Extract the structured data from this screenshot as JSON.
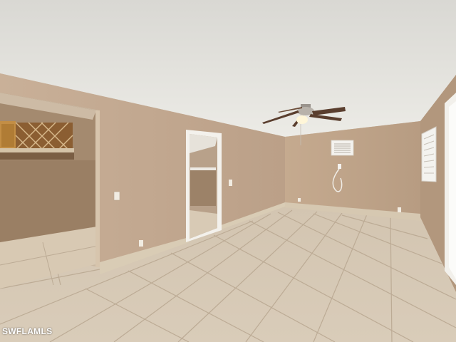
{
  "photo": {
    "subject": "empty-room-interior",
    "elements": [
      "ceiling",
      "ceiling-fan",
      "doorway",
      "closet-opening",
      "window",
      "wall-vent",
      "tile-floor"
    ],
    "colors": {
      "ceiling": "#e4e3de",
      "wall": "#c2a78c",
      "wall_shadow": "#a88d72",
      "floor": "#d9ccb8",
      "floor_grout": "#bfae98",
      "baseboard": "#d8cbb4",
      "trim": "#f2f0ea",
      "fan_blade": "#5a3e2e"
    }
  },
  "watermark": {
    "text": "SWFLAMLS"
  }
}
